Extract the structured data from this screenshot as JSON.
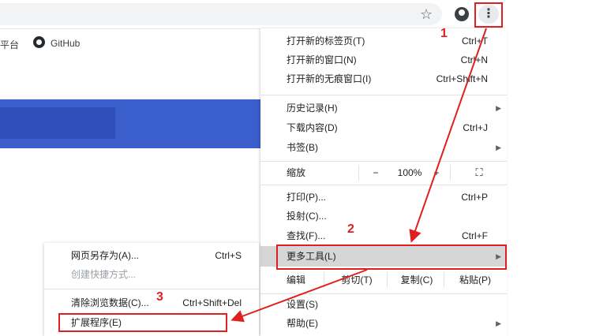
{
  "toolbar": {
    "star_icon": "star-icon",
    "profile_icon": "account-circle-icon",
    "menu_icon": "kebab-menu-icon",
    "menu_glyph": "⋮"
  },
  "bookmarks": {
    "left_fragment": "平台",
    "github_label": "GitHub"
  },
  "menu": {
    "new_tab": {
      "label": "打开新的标签页(T)",
      "shortcut": "Ctrl+T"
    },
    "new_window": {
      "label": "打开新的窗口(N)",
      "shortcut": "Ctrl+N"
    },
    "incognito": {
      "label": "打开新的无痕窗口(I)",
      "shortcut": "Ctrl+Shift+N"
    },
    "history": {
      "label": "历史记录(H)",
      "arrow": "▶"
    },
    "downloads": {
      "label": "下载内容(D)",
      "shortcut": "Ctrl+J"
    },
    "bookmarks": {
      "label": "书签(B)",
      "arrow": "▶"
    },
    "zoom": {
      "label": "缩放",
      "minus": "−",
      "value": "100%",
      "plus": "+",
      "fullscreen": "⛶"
    },
    "print": {
      "label": "打印(P)...",
      "shortcut": "Ctrl+P"
    },
    "cast": {
      "label": "投射(C)..."
    },
    "find": {
      "label": "查找(F)...",
      "shortcut": "Ctrl+F"
    },
    "more_tools": {
      "label": "更多工具(L)",
      "arrow": "▶"
    },
    "edit": {
      "label": "编辑",
      "cut": "剪切(T)",
      "copy": "复制(C)",
      "paste": "粘贴(P)"
    },
    "settings": {
      "label": "设置(S)"
    },
    "help": {
      "label": "帮助(E)",
      "arrow": "▶"
    }
  },
  "submenu": {
    "save_page": {
      "label": "网页另存为(A)...",
      "shortcut": "Ctrl+S"
    },
    "create_shortcut": {
      "label": "创建快捷方式..."
    },
    "clear_data": {
      "label": "清除浏览数据(C)...",
      "shortcut": "Ctrl+Shift+Del"
    },
    "extensions": {
      "label": "扩展程序(E)"
    }
  },
  "annotations": {
    "step1": "1",
    "step2": "2",
    "step3": "3",
    "color": "#e02020"
  }
}
